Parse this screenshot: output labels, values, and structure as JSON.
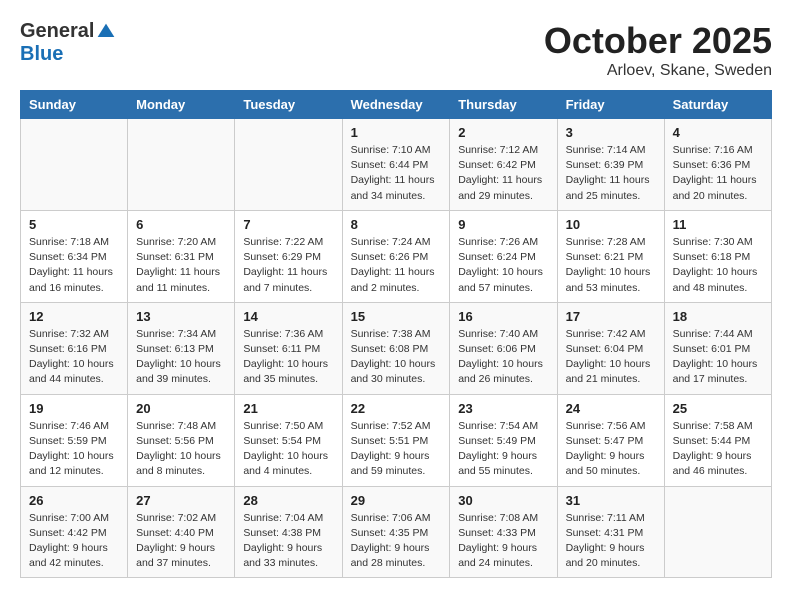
{
  "header": {
    "logo_general": "General",
    "logo_blue": "Blue",
    "month": "October 2025",
    "location": "Arloev, Skane, Sweden"
  },
  "weekdays": [
    "Sunday",
    "Monday",
    "Tuesday",
    "Wednesday",
    "Thursday",
    "Friday",
    "Saturday"
  ],
  "weeks": [
    [
      {
        "day": "",
        "info": ""
      },
      {
        "day": "",
        "info": ""
      },
      {
        "day": "",
        "info": ""
      },
      {
        "day": "1",
        "info": "Sunrise: 7:10 AM\nSunset: 6:44 PM\nDaylight: 11 hours and 34 minutes."
      },
      {
        "day": "2",
        "info": "Sunrise: 7:12 AM\nSunset: 6:42 PM\nDaylight: 11 hours and 29 minutes."
      },
      {
        "day": "3",
        "info": "Sunrise: 7:14 AM\nSunset: 6:39 PM\nDaylight: 11 hours and 25 minutes."
      },
      {
        "day": "4",
        "info": "Sunrise: 7:16 AM\nSunset: 6:36 PM\nDaylight: 11 hours and 20 minutes."
      }
    ],
    [
      {
        "day": "5",
        "info": "Sunrise: 7:18 AM\nSunset: 6:34 PM\nDaylight: 11 hours and 16 minutes."
      },
      {
        "day": "6",
        "info": "Sunrise: 7:20 AM\nSunset: 6:31 PM\nDaylight: 11 hours and 11 minutes."
      },
      {
        "day": "7",
        "info": "Sunrise: 7:22 AM\nSunset: 6:29 PM\nDaylight: 11 hours and 7 minutes."
      },
      {
        "day": "8",
        "info": "Sunrise: 7:24 AM\nSunset: 6:26 PM\nDaylight: 11 hours and 2 minutes."
      },
      {
        "day": "9",
        "info": "Sunrise: 7:26 AM\nSunset: 6:24 PM\nDaylight: 10 hours and 57 minutes."
      },
      {
        "day": "10",
        "info": "Sunrise: 7:28 AM\nSunset: 6:21 PM\nDaylight: 10 hours and 53 minutes."
      },
      {
        "day": "11",
        "info": "Sunrise: 7:30 AM\nSunset: 6:18 PM\nDaylight: 10 hours and 48 minutes."
      }
    ],
    [
      {
        "day": "12",
        "info": "Sunrise: 7:32 AM\nSunset: 6:16 PM\nDaylight: 10 hours and 44 minutes."
      },
      {
        "day": "13",
        "info": "Sunrise: 7:34 AM\nSunset: 6:13 PM\nDaylight: 10 hours and 39 minutes."
      },
      {
        "day": "14",
        "info": "Sunrise: 7:36 AM\nSunset: 6:11 PM\nDaylight: 10 hours and 35 minutes."
      },
      {
        "day": "15",
        "info": "Sunrise: 7:38 AM\nSunset: 6:08 PM\nDaylight: 10 hours and 30 minutes."
      },
      {
        "day": "16",
        "info": "Sunrise: 7:40 AM\nSunset: 6:06 PM\nDaylight: 10 hours and 26 minutes."
      },
      {
        "day": "17",
        "info": "Sunrise: 7:42 AM\nSunset: 6:04 PM\nDaylight: 10 hours and 21 minutes."
      },
      {
        "day": "18",
        "info": "Sunrise: 7:44 AM\nSunset: 6:01 PM\nDaylight: 10 hours and 17 minutes."
      }
    ],
    [
      {
        "day": "19",
        "info": "Sunrise: 7:46 AM\nSunset: 5:59 PM\nDaylight: 10 hours and 12 minutes."
      },
      {
        "day": "20",
        "info": "Sunrise: 7:48 AM\nSunset: 5:56 PM\nDaylight: 10 hours and 8 minutes."
      },
      {
        "day": "21",
        "info": "Sunrise: 7:50 AM\nSunset: 5:54 PM\nDaylight: 10 hours and 4 minutes."
      },
      {
        "day": "22",
        "info": "Sunrise: 7:52 AM\nSunset: 5:51 PM\nDaylight: 9 hours and 59 minutes."
      },
      {
        "day": "23",
        "info": "Sunrise: 7:54 AM\nSunset: 5:49 PM\nDaylight: 9 hours and 55 minutes."
      },
      {
        "day": "24",
        "info": "Sunrise: 7:56 AM\nSunset: 5:47 PM\nDaylight: 9 hours and 50 minutes."
      },
      {
        "day": "25",
        "info": "Sunrise: 7:58 AM\nSunset: 5:44 PM\nDaylight: 9 hours and 46 minutes."
      }
    ],
    [
      {
        "day": "26",
        "info": "Sunrise: 7:00 AM\nSunset: 4:42 PM\nDaylight: 9 hours and 42 minutes."
      },
      {
        "day": "27",
        "info": "Sunrise: 7:02 AM\nSunset: 4:40 PM\nDaylight: 9 hours and 37 minutes."
      },
      {
        "day": "28",
        "info": "Sunrise: 7:04 AM\nSunset: 4:38 PM\nDaylight: 9 hours and 33 minutes."
      },
      {
        "day": "29",
        "info": "Sunrise: 7:06 AM\nSunset: 4:35 PM\nDaylight: 9 hours and 28 minutes."
      },
      {
        "day": "30",
        "info": "Sunrise: 7:08 AM\nSunset: 4:33 PM\nDaylight: 9 hours and 24 minutes."
      },
      {
        "day": "31",
        "info": "Sunrise: 7:11 AM\nSunset: 4:31 PM\nDaylight: 9 hours and 20 minutes."
      },
      {
        "day": "",
        "info": ""
      }
    ]
  ]
}
